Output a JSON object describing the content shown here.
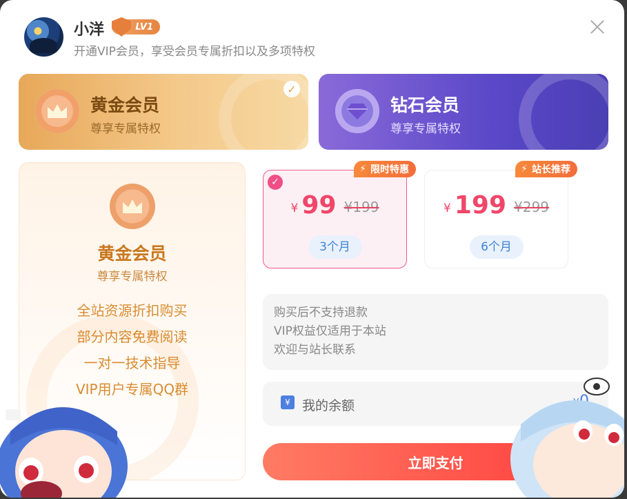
{
  "header": {
    "username": "小洋",
    "level_badge": "LV1",
    "subtitle": "开通VIP会员，享受会员专属折扣以及多项特权"
  },
  "tiers": [
    {
      "title": "黄金会员",
      "subtitle": "尊享专属特权",
      "selected": true
    },
    {
      "title": "钻石会员",
      "subtitle": "尊享专属特权",
      "selected": false
    }
  ],
  "benefits": {
    "title": "黄金会员",
    "subtitle": "尊享专属特权",
    "items": [
      "全站资源折扣购买",
      "部分内容免费阅读",
      "一对一技术指导",
      "VIP用户专属QQ群"
    ]
  },
  "prices": [
    {
      "tag": "限时特惠",
      "currency": "¥",
      "amount": "99",
      "original": "¥199",
      "period": "3个月",
      "selected": true
    },
    {
      "tag": "站长推荐",
      "currency": "¥",
      "amount": "199",
      "original": "¥299",
      "period": "6个月",
      "selected": false
    }
  ],
  "notice": [
    "购买后不支持退款",
    "VIP权益仅适用于本站",
    "欢迎与站长联系"
  ],
  "balance": {
    "label": "我的余额",
    "currency": "¥",
    "value": "0"
  },
  "pay_button": "立即支付",
  "colors": {
    "accent": "#ff3b3b",
    "gold": "#e7a85a",
    "diamond": "#5a48c8",
    "price": "#f0466a"
  },
  "icons": {
    "close": "close-icon",
    "lightning": "lightning-icon",
    "wallet": "wallet-icon",
    "check": "check-icon",
    "crown": "crown-icon",
    "diamond": "diamond-icon"
  }
}
